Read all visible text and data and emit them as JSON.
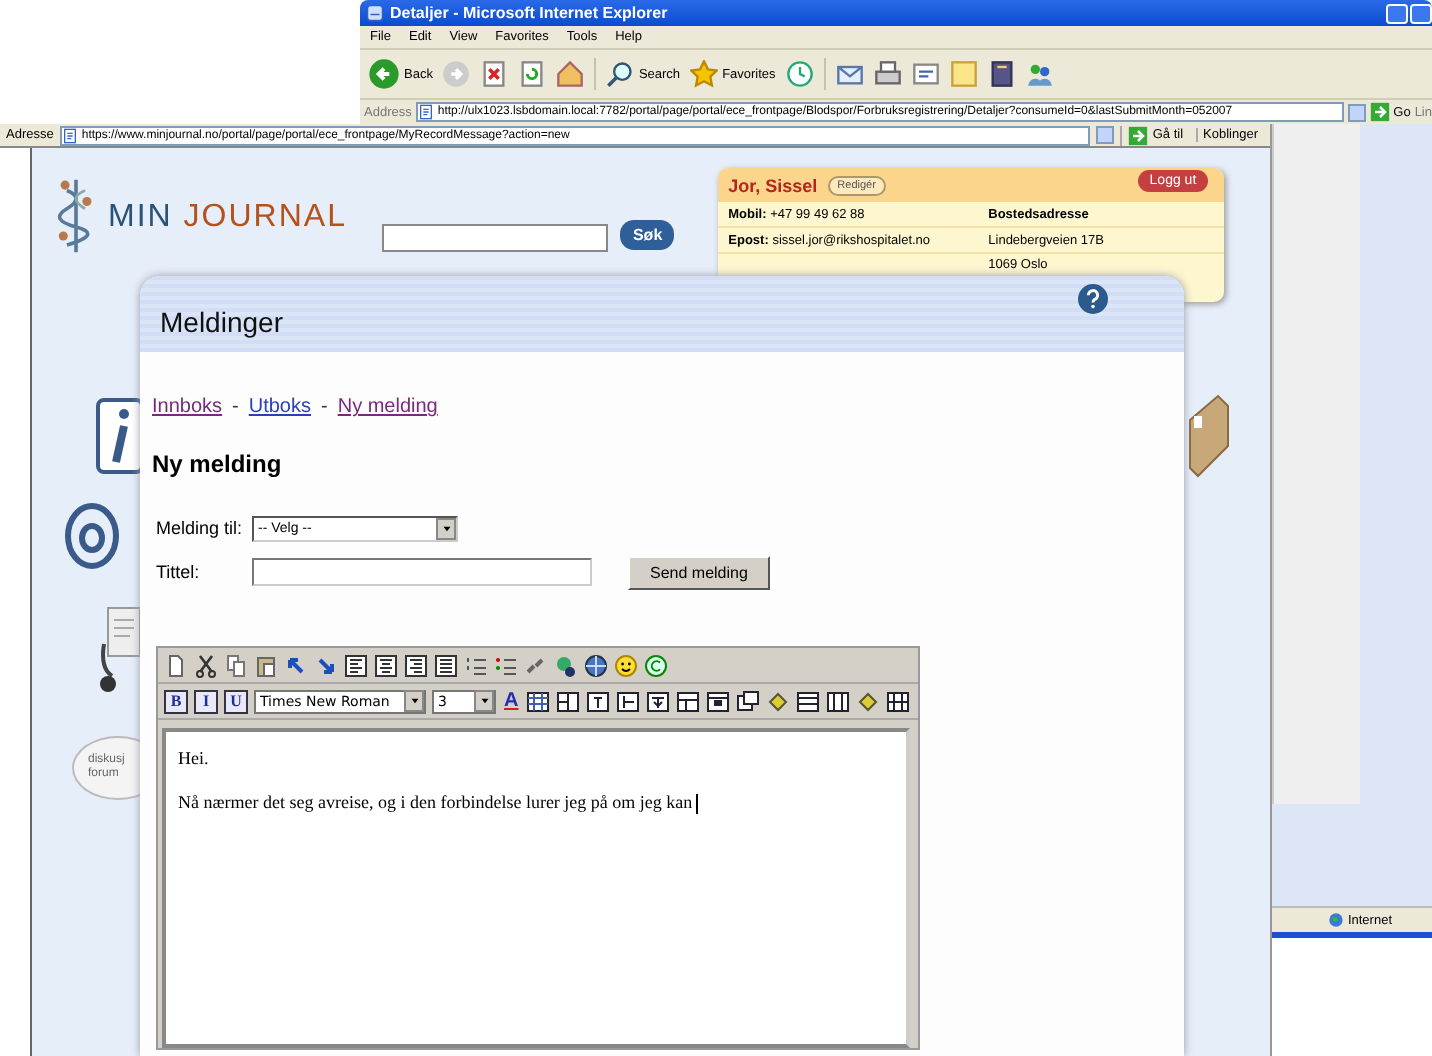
{
  "back_window": {
    "title": "Detaljer - Microsoft Internet Explorer",
    "menu": [
      "File",
      "Edit",
      "View",
      "Favorites",
      "Tools",
      "Help"
    ],
    "toolbar": {
      "back": "Back",
      "search": "Search",
      "favorites": "Favorites"
    },
    "address": {
      "label": "Address",
      "url": "http://ulx1023.lsbdomain.local:7782/portal/page/portal/ece_frontpage/Blodspor/Forbruksregistrering/Detaljer?consumeId=0&lastSubmitMonth=052007"
    },
    "go": "Go",
    "links": "Lin",
    "status_zone": "Internet"
  },
  "front_window": {
    "address": {
      "label": "Adresse",
      "url": "https://www.minjournal.no/portal/page/portal/ece_frontpage/MyRecordMessage?action=new"
    },
    "go": "Gå til",
    "links": "Koblinger"
  },
  "site": {
    "logo": [
      "MIN",
      "JOURNAL"
    ],
    "search_button": "Søk",
    "forum_bubble": [
      "diskusj",
      "forum"
    ]
  },
  "user_card": {
    "name": "Jor, Sissel",
    "edit": "Redigér",
    "logout": "Logg ut",
    "rows": [
      {
        "label": "Mobil:",
        "value": "+47 99 49 62 88",
        "address": "Bostedsadresse",
        "heading": true
      },
      {
        "label": "Epost:",
        "value": "sissel.jor@rikshospitalet.no",
        "address": "Lindebergveien 17B",
        "heading": false
      },
      {
        "address": "1069 Oslo",
        "heading": false
      }
    ]
  },
  "dialog": {
    "title": "Meldinger",
    "nav": [
      {
        "label": "Innboks",
        "visited": true
      },
      {
        "label": "Utboks",
        "visited": false
      },
      {
        "label": "Ny melding",
        "visited": true
      }
    ],
    "nav_separators": [
      "-",
      "-"
    ],
    "heading": "Ny melding",
    "fields": [
      {
        "label": "Melding til:",
        "kind": "select",
        "value": "-- Velg --"
      },
      {
        "label": "Tittel:",
        "kind": "text"
      }
    ],
    "send_button": "Send melding",
    "editor": {
      "format_buttons": [
        "B",
        "I",
        "U"
      ],
      "font": "Times New Roman",
      "size": "3",
      "font_color": "A",
      "paragraphs": [
        "Hei.",
        "Nå nærmer det seg avreise, og i den forbindelse lurer jeg på om jeg kan"
      ]
    }
  }
}
